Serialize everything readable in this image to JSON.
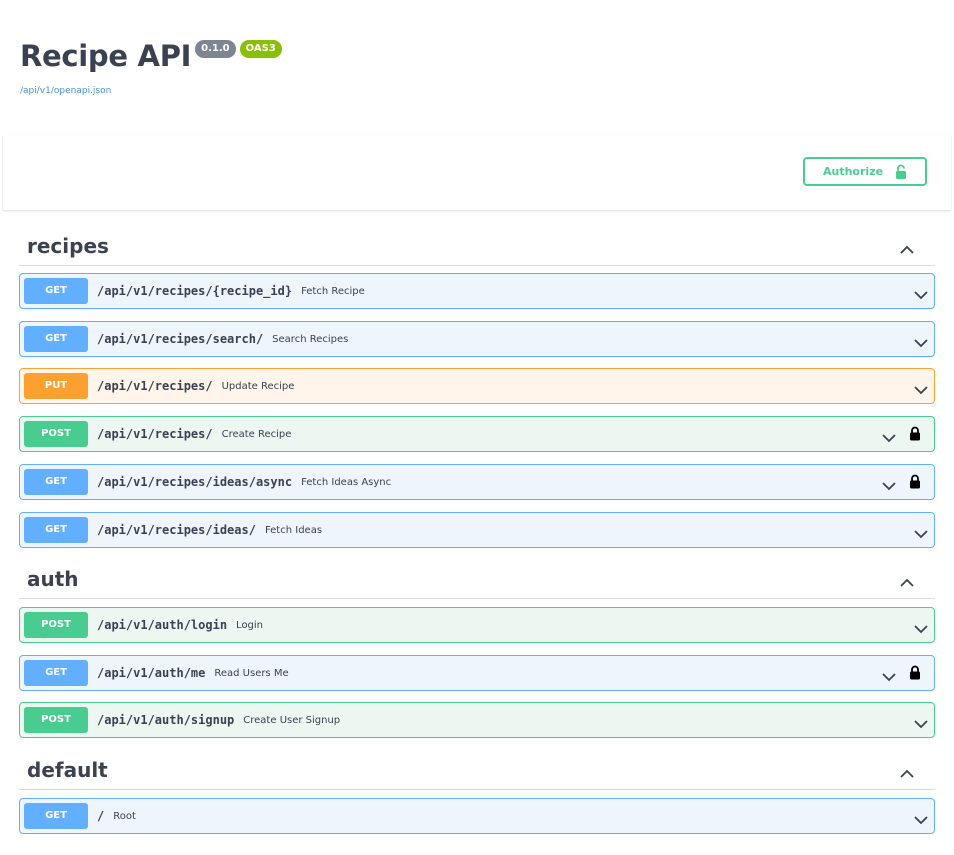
{
  "info": {
    "title": "Recipe API",
    "version": "0.1.0",
    "oas": "OAS3",
    "spec_url": "/api/v1/openapi.json"
  },
  "auth": {
    "authorize_label": "Authorize"
  },
  "tags": [
    {
      "name": "recipes",
      "operations": [
        {
          "method": "GET",
          "path": "/api/v1/recipes/{recipe_id}",
          "summary": "Fetch Recipe",
          "locked": false
        },
        {
          "method": "GET",
          "path": "/api/v1/recipes/search/",
          "summary": "Search Recipes",
          "locked": false
        },
        {
          "method": "PUT",
          "path": "/api/v1/recipes/",
          "summary": "Update Recipe",
          "locked": false
        },
        {
          "method": "POST",
          "path": "/api/v1/recipes/",
          "summary": "Create Recipe",
          "locked": true
        },
        {
          "method": "GET",
          "path": "/api/v1/recipes/ideas/async",
          "summary": "Fetch Ideas Async",
          "locked": true
        },
        {
          "method": "GET",
          "path": "/api/v1/recipes/ideas/",
          "summary": "Fetch Ideas",
          "locked": false
        }
      ]
    },
    {
      "name": "auth",
      "operations": [
        {
          "method": "POST",
          "path": "/api/v1/auth/login",
          "summary": "Login",
          "locked": false
        },
        {
          "method": "GET",
          "path": "/api/v1/auth/me",
          "summary": "Read Users Me",
          "locked": true
        },
        {
          "method": "POST",
          "path": "/api/v1/auth/signup",
          "summary": "Create User Signup",
          "locked": false
        }
      ]
    },
    {
      "name": "default",
      "operations": [
        {
          "method": "GET",
          "path": "/",
          "summary": "Root",
          "locked": false
        }
      ]
    }
  ],
  "colors": {
    "get": "#61affe",
    "put": "#fca130",
    "post": "#49cc90",
    "text": "#3b4151",
    "link": "#4990e2"
  }
}
